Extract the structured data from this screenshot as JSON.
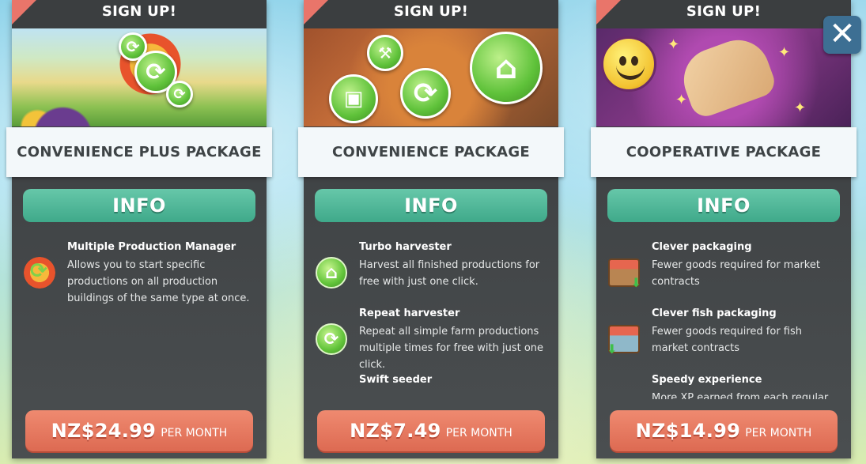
{
  "close_label": "✕",
  "cards": [
    {
      "header": "SIGN UP!",
      "title": "CONVENIENCE PLUS PACKAGE",
      "info_label": "INFO",
      "features": [
        {
          "icon": "multi-production-icon",
          "title": "Multiple Production Manager",
          "description": "Allows you to start specific productions on all production buildings of the same type at once."
        }
      ],
      "price": "NZ$24.99",
      "period": "PER MONTH"
    },
    {
      "header": "SIGN UP!",
      "title": "CONVENIENCE PACKAGE",
      "info_label": "INFO",
      "features": [
        {
          "icon": "turbo-harvester-icon",
          "title": "Turbo harvester",
          "description": "Harvest all finished productions for free with just one click."
        },
        {
          "icon": "repeat-harvester-icon",
          "title": "Repeat harvester",
          "description": "Repeat all simple farm productions multiple times for free with just one click."
        },
        {
          "icon": "swift-seeder-icon",
          "title": "Swift seeder",
          "description": ""
        }
      ],
      "price": "NZ$7.49",
      "period": "PER MONTH"
    },
    {
      "header": "SIGN UP!",
      "title": "COOPERATIVE PACKAGE",
      "info_label": "INFO",
      "features": [
        {
          "icon": "market-crate-icon",
          "title": "Clever packaging",
          "description": "Fewer goods required for market contracts"
        },
        {
          "icon": "fish-crate-icon",
          "title": "Clever fish packaging",
          "description": "Fewer goods required for fish market contracts"
        },
        {
          "icon": "xp-boost-icon",
          "title": "Speedy experience",
          "description": "More XP earned from each regular farm"
        }
      ],
      "price": "NZ$14.99",
      "period": "PER MONTH"
    }
  ]
}
